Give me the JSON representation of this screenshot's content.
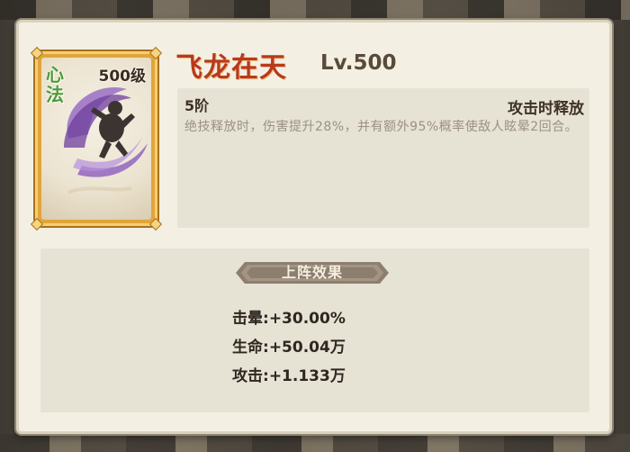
{
  "card": {
    "level_badge": "500级",
    "type_label": "心法"
  },
  "skill": {
    "name": "飞龙在天",
    "level": "Lv.500",
    "tier": "5阶",
    "trigger": "攻击时释放",
    "description": "绝技释放时，伤害提升28%，并有额外95%概率使敌人眩晕2回合。"
  },
  "effects": {
    "title": "上阵效果",
    "stats": [
      {
        "label": "击晕",
        "value": "+30.00%"
      },
      {
        "label": "生命",
        "value": "+50.04万"
      },
      {
        "label": "攻击",
        "value": "+1.133万"
      }
    ]
  },
  "colors": {
    "skill_name": "#b8391e",
    "card_frame": "#e0a53a",
    "type_label": "#4e9a36",
    "effect_banner": "#8c7f70"
  }
}
